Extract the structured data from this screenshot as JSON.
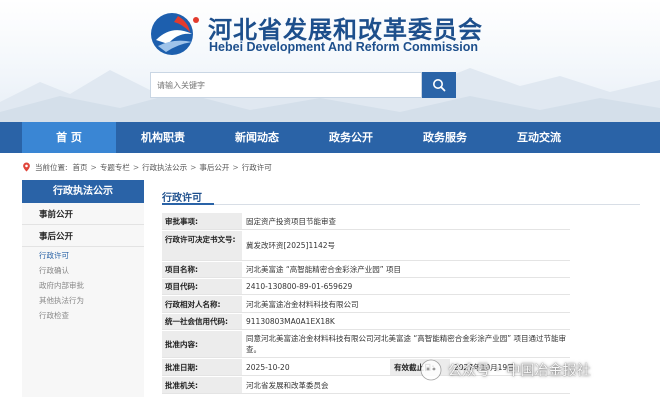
{
  "header": {
    "title_cn": "河北省发展和改革委员会",
    "title_en": "Hebei Development And Reform Commission",
    "logo_icon": "hebei-logo-icon",
    "brand_color": "#2a63a7"
  },
  "search": {
    "placeholder": "请输入关键字",
    "button_icon": "search-icon"
  },
  "nav": {
    "items": [
      {
        "label": "首  页",
        "active": true
      },
      {
        "label": "机构职责"
      },
      {
        "label": "新闻动态"
      },
      {
        "label": "政务公开"
      },
      {
        "label": "政务服务"
      },
      {
        "label": "互动交流"
      }
    ]
  },
  "breadcrumb": {
    "prefix": "当前位置:",
    "items": [
      "首页",
      "专题专栏",
      "行政执法公示",
      "事后公开",
      "行政许可"
    ],
    "separator": ">"
  },
  "sidebar": {
    "title": "行政执法公示",
    "group1": "事前公开",
    "group2": "事后公开",
    "subs": [
      "行政许可",
      "行政确认",
      "政府内部审批",
      "其他执法行为",
      "行政检查"
    ]
  },
  "main": {
    "title": "行政许可",
    "rows": [
      {
        "label": "审批事项:",
        "value": "固定资产投资项目节能审查"
      },
      {
        "label": "行政许可决定书文号:",
        "value": "冀发改环资[2025]1142号"
      },
      {
        "label": "项目名称:",
        "value": "河北美富途 “高智能精密合金彩涂产业园” 项目"
      },
      {
        "label": "项目代码:",
        "value": "2410-130800-89-01-659629"
      },
      {
        "label": "行政相对人名称:",
        "value": "河北美富途冶金材料科技有限公司"
      },
      {
        "label": "统一社会信用代码:",
        "value": "91130803MA0A1EX18K"
      },
      {
        "label": "批准内容:",
        "value": "同意河北美富途冶金材料科技有限公司河北美富途 “高智能精密合金彩涂产业园” 项目通过节能审查。"
      },
      {
        "label": "批准日期:",
        "value": "2025-10-20",
        "label2": "有效截止日:",
        "value2": "2027年10月19日"
      },
      {
        "label": "批准机关:",
        "value": "河北省发展和改革委员会"
      }
    ]
  },
  "watermark": {
    "prefix": "公众号",
    "text": "中国冶金报社"
  }
}
